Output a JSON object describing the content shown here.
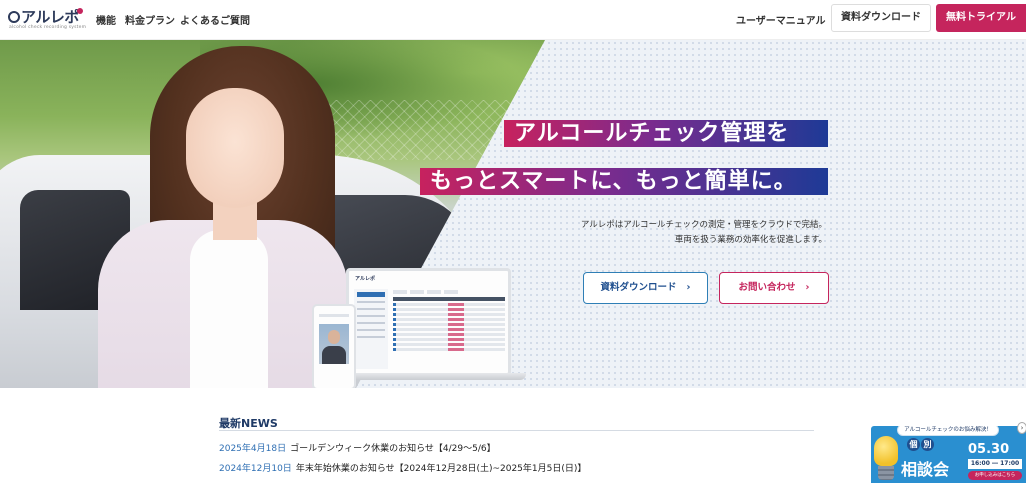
{
  "header": {
    "logo_text": "アルレポ",
    "logo_sub": "alcohol check recording system",
    "nav": [
      "機能",
      "料金プラン",
      "よくあるご質問"
    ],
    "manual_label": "ユーザーマニュアル",
    "docs_label": "資料ダウンロード",
    "trial_label": "無料トライアル"
  },
  "hero": {
    "headline_1": "アルコールチェック管理を",
    "headline_2": "もっとスマートに、もっと簡単に。",
    "desc_1": "アルレポはアルコールチェックの測定・管理をクラウドで完結。",
    "desc_2": "車両を扱う業務の効率化を促進します。",
    "btn_docs": "資料ダウンロード",
    "btn_contact": "お問い合わせ",
    "device_logo": "アルレポ"
  },
  "news": {
    "title": "最新NEWS",
    "items": [
      {
        "date": "2025年4月18日",
        "text": "ゴールデンウィーク休業のお知らせ【4/29～5/6】"
      },
      {
        "date": "2024年12月10日",
        "text": "年末年始休業のお知らせ【2024年12月28日(土)~2025年1月5日(日)】"
      }
    ]
  },
  "banner": {
    "top": "アルコールチェックのお悩み解決！",
    "kobetsu_1": "個",
    "kobetsu_2": "別",
    "soudan": "相談会",
    "date": "05.30",
    "time": "16:00 ― 17:00",
    "apply": "お申し込みはこちら"
  },
  "colors": {
    "brand_pink": "#c5255d",
    "brand_navy": "#1f3a66",
    "accent_blue": "#2f7fb6"
  }
}
